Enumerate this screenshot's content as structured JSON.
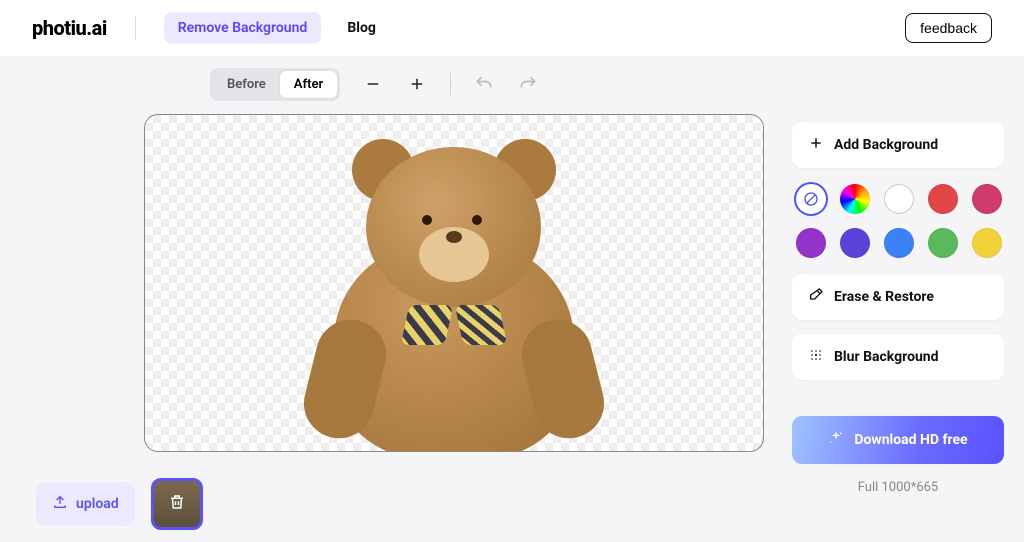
{
  "header": {
    "logo_text": "photiu.ai",
    "nav_remove_bg": "Remove Background",
    "nav_blog": "Blog",
    "feedback": "feedback"
  },
  "toolbar": {
    "before": "Before",
    "after": "After"
  },
  "side": {
    "add_bg": "Add Background",
    "erase_restore": "Erase & Restore",
    "blur_bg": "Blur Background",
    "download": "Download HD free",
    "meta": "Full 1000*665",
    "colors": {
      "red": "#e14747",
      "pink": "#d13a6e",
      "purple": "#9333c7",
      "indigo": "#5a43d6",
      "blue": "#3b82f6",
      "green": "#5bb85b",
      "yellow": "#f2d23a"
    }
  },
  "footer": {
    "upload": "upload"
  }
}
